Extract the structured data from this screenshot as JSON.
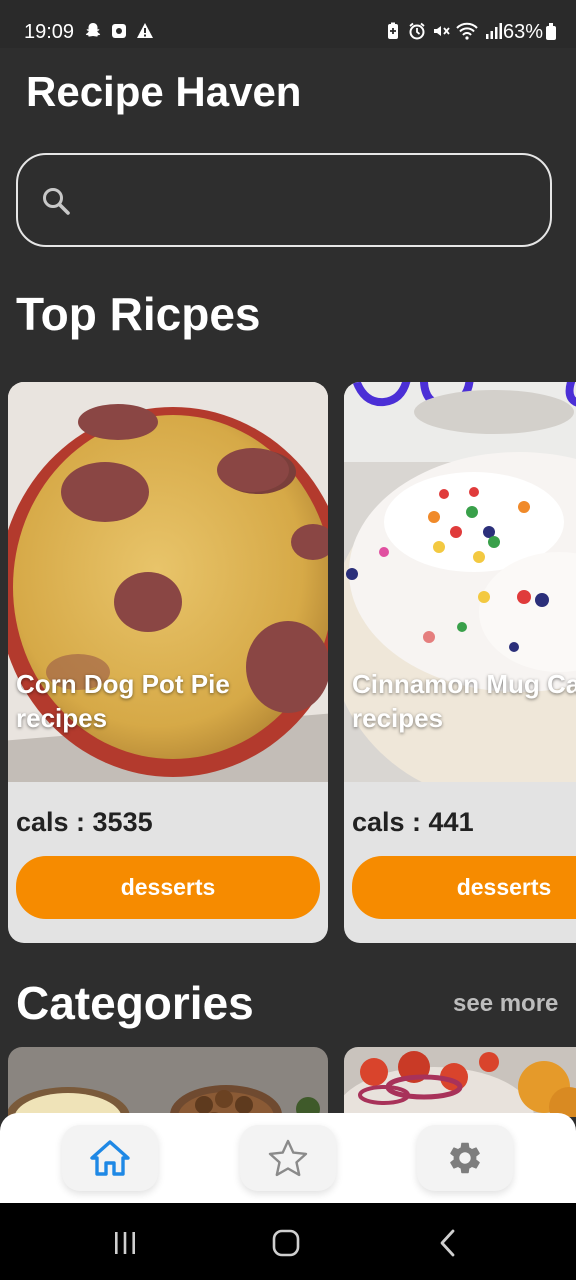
{
  "status_bar": {
    "time": "19:09",
    "battery": "63%",
    "left_icons": [
      "snapchat-icon",
      "app-icon",
      "alert-icon"
    ],
    "right_icons": [
      "battery-saver-icon",
      "alarm-icon",
      "mute-icon",
      "wifi-icon",
      "signal-icon"
    ]
  },
  "header": {
    "title": "Recipe Haven"
  },
  "search": {
    "placeholder": "",
    "value": "",
    "icon": "search-icon"
  },
  "top_recipes": {
    "title": "Top Ricpes",
    "cards": [
      {
        "name": "Corn Dog Pot Pie recipes",
        "cals": "cals : 3535",
        "category": "desserts"
      },
      {
        "name": "Cinnamon Mug Cake recipes",
        "cals": "cals : 441",
        "category": "desserts"
      }
    ]
  },
  "categories": {
    "title": "Categories",
    "see_more": "see more"
  },
  "bottom_nav": {
    "items": [
      {
        "icon": "home-icon",
        "active": true
      },
      {
        "icon": "star-icon",
        "active": false
      },
      {
        "icon": "gear-icon",
        "active": false
      }
    ]
  },
  "colors": {
    "background": "#2e2e2e",
    "accent": "#f68b00",
    "card": "#e3e3e3",
    "nav_active": "#1e88e5"
  }
}
